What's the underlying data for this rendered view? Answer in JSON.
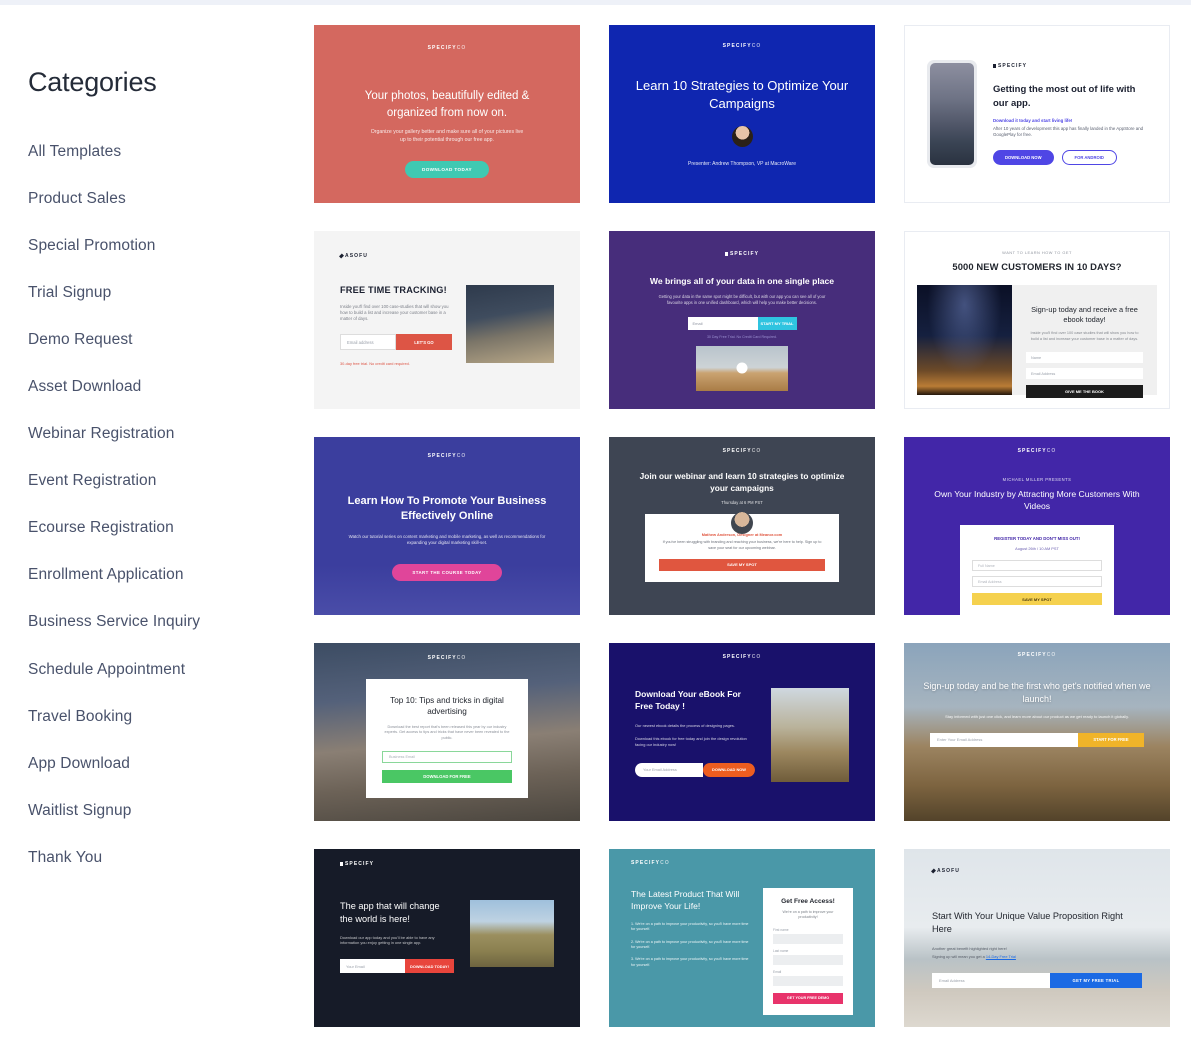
{
  "sidebar": {
    "title": "Categories",
    "items": [
      {
        "label": "All Templates"
      },
      {
        "label": "Product Sales"
      },
      {
        "label": "Special Promotion"
      },
      {
        "label": "Trial Signup"
      },
      {
        "label": "Demo Request"
      },
      {
        "label": "Asset Download"
      },
      {
        "label": "Webinar Registration"
      },
      {
        "label": "Event Registration"
      },
      {
        "label": "Ecourse Registration"
      },
      {
        "label": "Enrollment Application"
      },
      {
        "label": "Business Service Inquiry"
      },
      {
        "label": "Schedule Appointment"
      },
      {
        "label": "Travel Booking"
      },
      {
        "label": "App Download"
      },
      {
        "label": "Waitlist Signup"
      },
      {
        "label": "Thank You"
      }
    ]
  },
  "templates": [
    {
      "id": "photos-organized",
      "bg": "#d4685f",
      "logo_bold": "SPECIFY",
      "logo_light": "CO",
      "headline": "Your photos, beautifully edited & organized from now on.",
      "subtext": "Organize your gallery better and make sure all of your pictures live up to their potential through our free app.",
      "cta": "DOWNLOAD TODAY",
      "cta_color": "#3fc9b2"
    },
    {
      "id": "learn-10-strategies",
      "bg": "#0f26b0",
      "logo_bold": "SPECIFY",
      "logo_light": "CO",
      "headline": "Learn 10 Strategies to Optimize Your Campaigns",
      "presenter": "Presenter: Andrew Thompson, VP at MacroWare"
    },
    {
      "id": "getting-most-out-of-life",
      "bg": "#ffffff",
      "logo_bold": "SPECIFY",
      "headline": "Getting the most out of life with our app.",
      "kicker": "Download it today and start living life!",
      "subtext": "After 10 years of development this app has finally landed in the AppStore and GooglePlay for free.",
      "cta_primary": "DOWNLOAD NOW",
      "cta_secondary": "FOR ANDROID",
      "accent": "#4f46e5"
    },
    {
      "id": "free-time-tracking",
      "bg": "#f4f4f4",
      "logo_bold": "ASOFU",
      "headline": "FREE TIME TRACKING!",
      "subtext": "Inside you'll find over 100 case-studies that will show you how to build a list and increase your customer base in a matter of days.",
      "placeholder": "Email address",
      "cta": "LET'S GO",
      "cta_color": "#dd5545",
      "footnote": "30-day free trial. No credit card required."
    },
    {
      "id": "data-single-place",
      "bg": "#472d7b",
      "logo_bold": "SPECIFY",
      "headline": "We brings all of your data in one single place",
      "subtext": "Getting your data in the same spot might be difficult, but with our app you can see all of your favourite apps in one unified dashboard, which will help you make better decisions.",
      "placeholder": "Email",
      "cta": "START MY TRIAL",
      "cta_color": "#2fc4e0",
      "footnote": "30 Day Free Trial. No Credit Card Required."
    },
    {
      "id": "5000-new-customers",
      "bg": "#ffffff",
      "kicker": "WANT TO LEARN HOW TO GET",
      "headline": "5000 NEW CUSTOMERS IN 10 DAYS?",
      "panel_headline": "Sign-up today and receive a free ebook today!",
      "panel_subtext": "Inside you'll find over 100 case studies that will show you how to build a list and increase your customer base in a matter of days.",
      "field_1": "Name",
      "field_2": "Email Address",
      "cta": "GIVE ME THE BOOK",
      "cta_color": "#1c1c1c"
    },
    {
      "id": "promote-business-online",
      "bg": "#3b3e9e",
      "logo_bold": "SPECIFY",
      "logo_light": "CO",
      "headline": "Learn How To Promote Your Business Effectively Online",
      "subtext": "Watch our tutorial series on content marketing and mobile marketing, as well as recommendations for expanding your digital marketing skill-set.",
      "cta": "START THE COURSE TODAY",
      "cta_color": "#e0459a"
    },
    {
      "id": "join-our-webinar",
      "bg": "#3e4553",
      "logo_bold": "SPECIFY",
      "logo_light": "CO",
      "headline": "Join our webinar and learn 10 strategies to optimize your campaigns",
      "time": "Thursday at 6 PM PST",
      "speaker": "Mathew Anderson, Designer at Meanor.com",
      "panel_subtext": "If you've been struggling with branding and reaching your business, we're here to help. Sign up to save your seat for our upcoming webinar.",
      "cta": "SAVE MY SPOT",
      "cta_color": "#e0563f"
    },
    {
      "id": "own-your-industry-videos",
      "bg": "#4226a8",
      "logo_bold": "SPECIFY",
      "logo_light": "CO",
      "kicker": "MICHAEL MILLER PRESENTS",
      "headline": "Own Your Industry by Attracting More Customers With Videos",
      "panel_headline": "REGISTER TODAY AND DON'T MISS OUT!",
      "panel_time": "August 26th / 10 AM PST",
      "field_1": "Full Name",
      "field_2": "Email Address",
      "cta": "SAVE MY SPOT",
      "cta_color": "#f5d14e"
    },
    {
      "id": "top-10-tips-tricks",
      "bg": "#45506a",
      "logo_bold": "SPECIFY",
      "logo_light": "CO",
      "panel_headline": "Top 10: Tips and tricks in digital advertising",
      "panel_subtext": "Download the best report that's been released this year by our industry experts. Get access to tips and tricks that have never been revealed to the public.",
      "placeholder": "Business Email",
      "cta": "DOWNLOAD FOR FREE",
      "cta_color": "#4ac764"
    },
    {
      "id": "download-your-ebook",
      "bg": "#19116b",
      "logo_bold": "SPECIFY",
      "logo_light": "CO",
      "headline": "Download Your eBook For Free Today !",
      "subtext_1": "Our newest ebook details the process of designing pages.",
      "subtext_2": "Download this ebook for free today and join the design revolution facing our industry now!",
      "placeholder": "Your Email Address",
      "cta": "DOWNLOAD NOW",
      "cta_color": "#ed5d20"
    },
    {
      "id": "signup-notified-launch",
      "bg": "#8d9aa8",
      "logo_bold": "SPECIFY",
      "logo_light": "CO",
      "headline": "Sign-up today and be the first who get's notified when we launch!",
      "subtext": "Stay informed with just one click, and learn more about our product as we get ready to launch it globally.",
      "placeholder": "Enter Your Email Address",
      "cta": "START FOR FREE",
      "cta_color": "#f0b429"
    },
    {
      "id": "app-change-the-world",
      "bg": "#161b28",
      "logo_bold": "SPECIFY",
      "headline": "The app that will change the world is here!",
      "subtext": "Download our app today and you'll be able to have any information you enjoy getting in one single app.",
      "placeholder": "Your Email",
      "cta": "DOWNLOAD TODAY!",
      "cta_color": "#e8453c"
    },
    {
      "id": "latest-product-improve-life",
      "bg": "#4a98a8",
      "logo_bold": "SPECIFY",
      "logo_light": "CO",
      "headline": "The Latest Product That Will Improve Your Life!",
      "bullets": [
        "1. We're on a path to improve your productivity, so you'll have more time for yourself.",
        "2. We're on a path to improve your productivity, so you'll have more time for yourself.",
        "3. We're on a path to improve your productivity, so you'll have more time for yourself."
      ],
      "panel_headline": "Get Free Access!",
      "panel_subtext": "We're on a path to improve your productivity!",
      "field_1": "First name",
      "field_2": "Last name",
      "field_3": "Email",
      "cta": "GET YOUR FREE DEMO",
      "cta_color": "#e8336b"
    },
    {
      "id": "unique-value-proposition",
      "bg": "#d7dde2",
      "logo_bold": "ASOFU",
      "headline": "Start With Your Unique Value Proposition Right Here",
      "subtext_1": "Another great benefit highlighted right here!",
      "subtext_2": "Signing up will mean you get a",
      "link": "14-Day Free Trial",
      "placeholder": "Email Address",
      "cta": "GET MY FREE TRIAL",
      "cta_color": "#1c6ae4"
    }
  ]
}
